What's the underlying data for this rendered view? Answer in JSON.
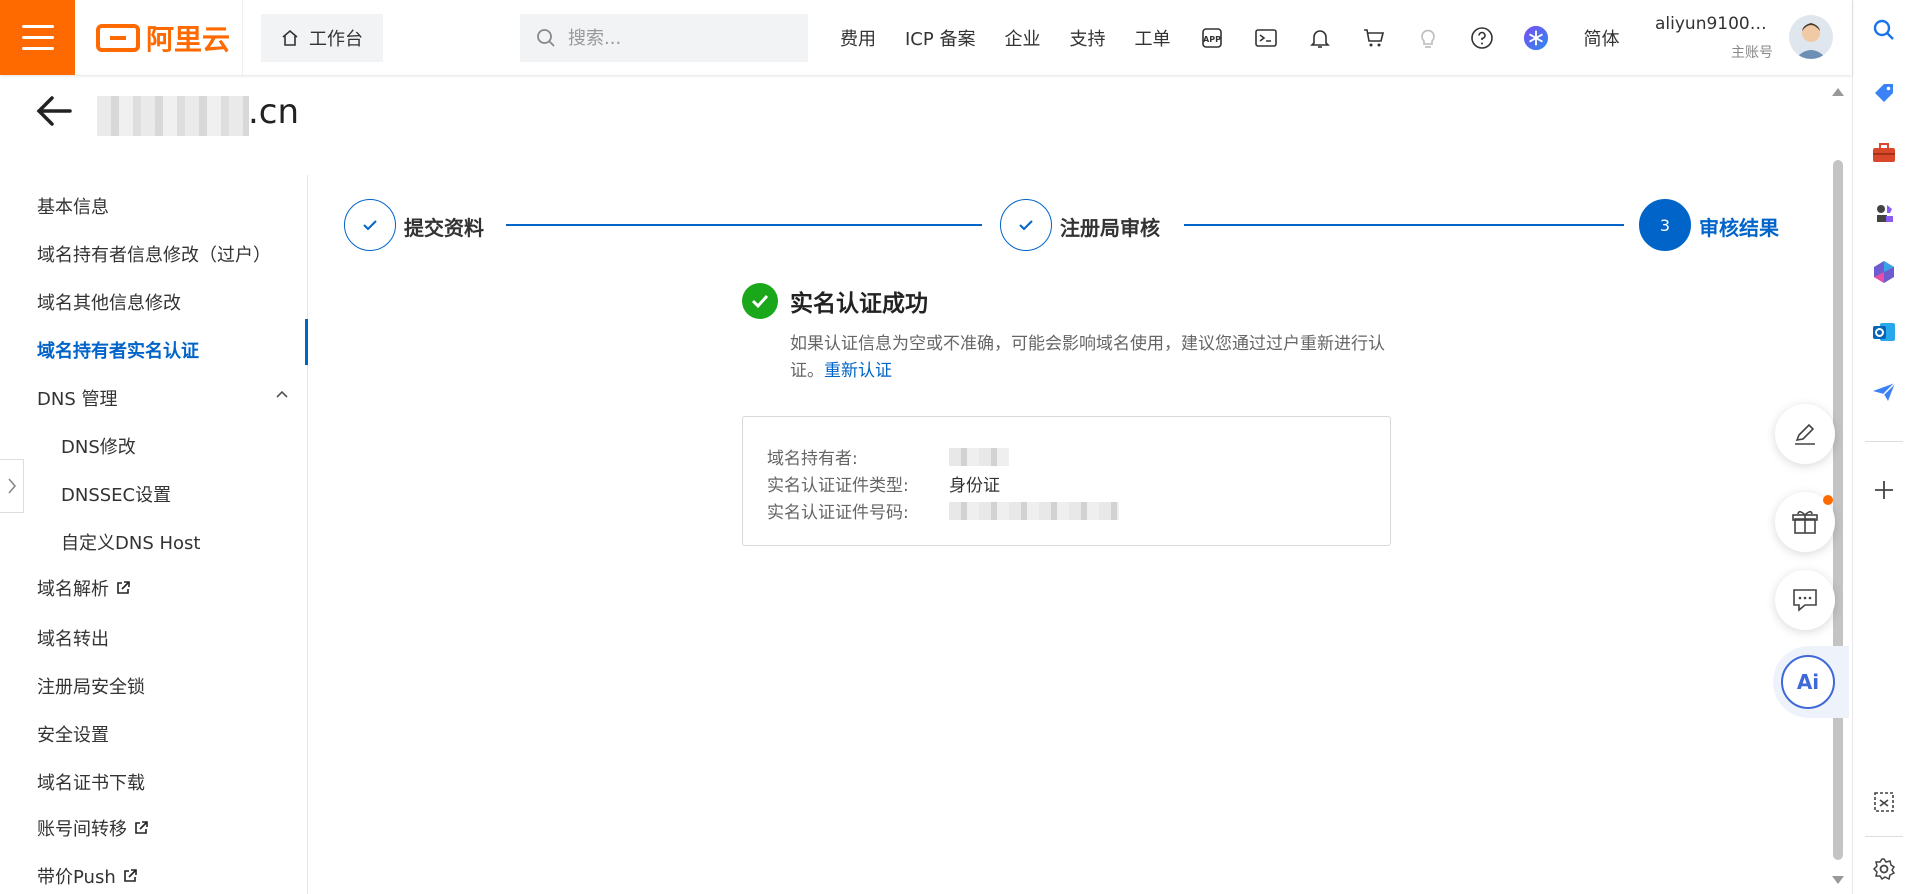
{
  "topbar": {
    "logo_text": "阿里云",
    "workbench_label": "工作台",
    "search_placeholder": "搜索...",
    "nav_links": [
      "费用",
      "ICP 备案",
      "企业",
      "支持",
      "工单"
    ],
    "lang_label": "简体",
    "user_name": "aliyun91003...",
    "user_role": "主账号",
    "brand_color": "#ff6a00"
  },
  "header": {
    "domain_suffix": ".cn"
  },
  "sidebar": {
    "items": [
      {
        "label": "基本信息"
      },
      {
        "label": "域名持有者信息修改（过户）"
      },
      {
        "label": "域名其他信息修改"
      },
      {
        "label": "域名持有者实名认证",
        "active": true
      },
      {
        "label": "DNS 管理",
        "expanded": true
      },
      {
        "label": "DNS修改",
        "sub": true
      },
      {
        "label": "DNSSEC设置",
        "sub": true
      },
      {
        "label": "自定义DNS Host",
        "sub": true
      },
      {
        "label": "域名解析",
        "external": true
      },
      {
        "label": "域名转出"
      },
      {
        "label": "注册局安全锁"
      },
      {
        "label": "安全设置"
      },
      {
        "label": "域名证书下载"
      },
      {
        "label": "账号间转移",
        "external": true
      },
      {
        "label": "带价Push",
        "external": true
      }
    ]
  },
  "steps": [
    {
      "label": "提交资料",
      "status": "done"
    },
    {
      "label": "注册局审核",
      "status": "done"
    },
    {
      "label": "审核结果",
      "status": "current",
      "number": "3"
    }
  ],
  "result": {
    "title": "实名认证成功",
    "desc": "如果认证信息为空或不准确，可能会影响域名使用，建议您通过过户重新进行认证。",
    "link": "重新认证"
  },
  "info": {
    "owner_label": "域名持有者:",
    "cert_type_label": "实名认证证件类型:",
    "cert_type_value": "身份证",
    "cert_no_label": "实名认证证件号码:"
  },
  "accent_color": "#0064c8",
  "success_color": "#1aa71a"
}
